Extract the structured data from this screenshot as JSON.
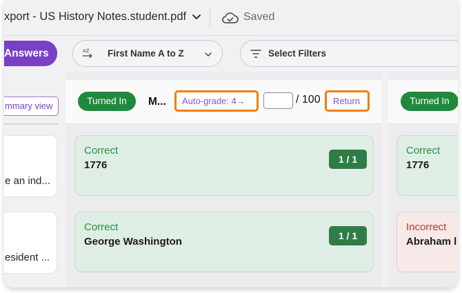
{
  "header": {
    "document_title": "xport - US History Notes.student.pdf",
    "save_status": "Saved"
  },
  "toolbar": {
    "answers_label": "Answers",
    "sort_label": "First Name A to Z",
    "filters_label": "Select Filters"
  },
  "left_panel": {
    "summary_view_label": "mmary view",
    "questions": [
      {
        "text": "e an ind..."
      },
      {
        "text": "esident ..."
      }
    ]
  },
  "students": [
    {
      "status": "Turned In",
      "name": "M...",
      "autograde_label": "Auto-grade: 4→",
      "score_value": "",
      "score_total": "/ 100",
      "return_label": "Return",
      "answers": [
        {
          "status": "Correct",
          "text": "1776",
          "points": "1 / 1"
        },
        {
          "status": "Correct",
          "text": "George Washington",
          "points": "1 / 1"
        }
      ]
    },
    {
      "status": "Turned In",
      "answers": [
        {
          "status": "Correct",
          "text": "1776"
        },
        {
          "status": "Incorrect",
          "text": "Abraham l"
        }
      ]
    }
  ],
  "colors": {
    "accent_purple": "#7b3fc6",
    "turned_in_green": "#1f8a3b",
    "highlight_orange": "#f07f00",
    "correct_green": "#2b8a45",
    "incorrect_red": "#cc2f2f"
  }
}
